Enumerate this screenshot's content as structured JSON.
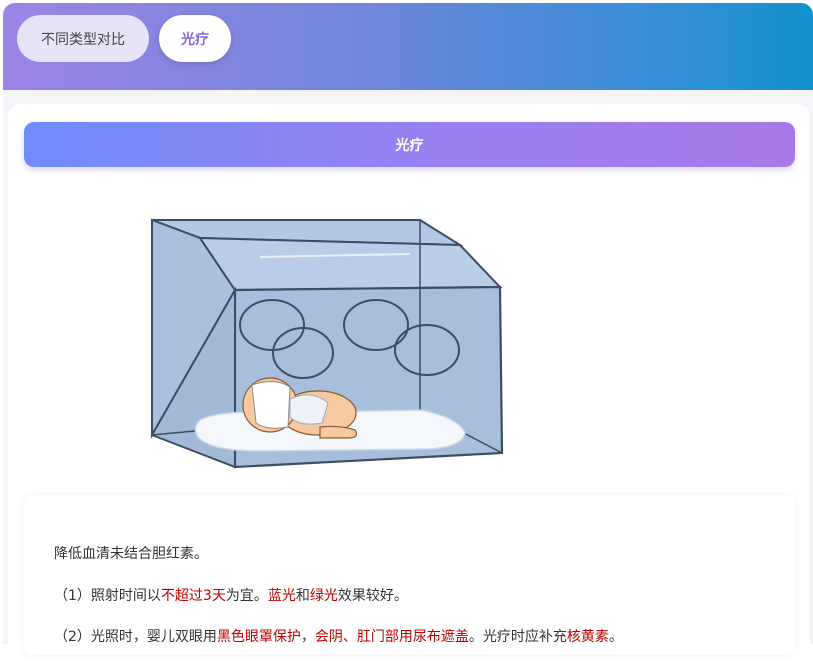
{
  "tabs": [
    {
      "label": "不同类型对比"
    },
    {
      "label": "光疗"
    }
  ],
  "title_bar": {
    "label": "光疗"
  },
  "illustration": {
    "icon": "incubator-baby-illustration"
  },
  "content": {
    "intro": "降低血清未结合胆红素。",
    "item1": {
      "prefix": "（1）照射时间以",
      "hl1": "不超过3天",
      "mid1": "为宜。",
      "hl2": "蓝光",
      "mid2": "和",
      "hl3": "绿光",
      "suffix": "效果较好。"
    },
    "item2": {
      "prefix": "（2）光照时，婴儿双眼用",
      "hl1": "黑色眼罩保护",
      "mid1": "，",
      "hl2": "会阴、肛门部用尿布遮盖",
      "mid2": "。光疗时应补充",
      "hl3": "核黄素",
      "suffix": "。"
    }
  },
  "colors": {
    "highlight": "#c00000",
    "accent": "#8b67dc"
  }
}
